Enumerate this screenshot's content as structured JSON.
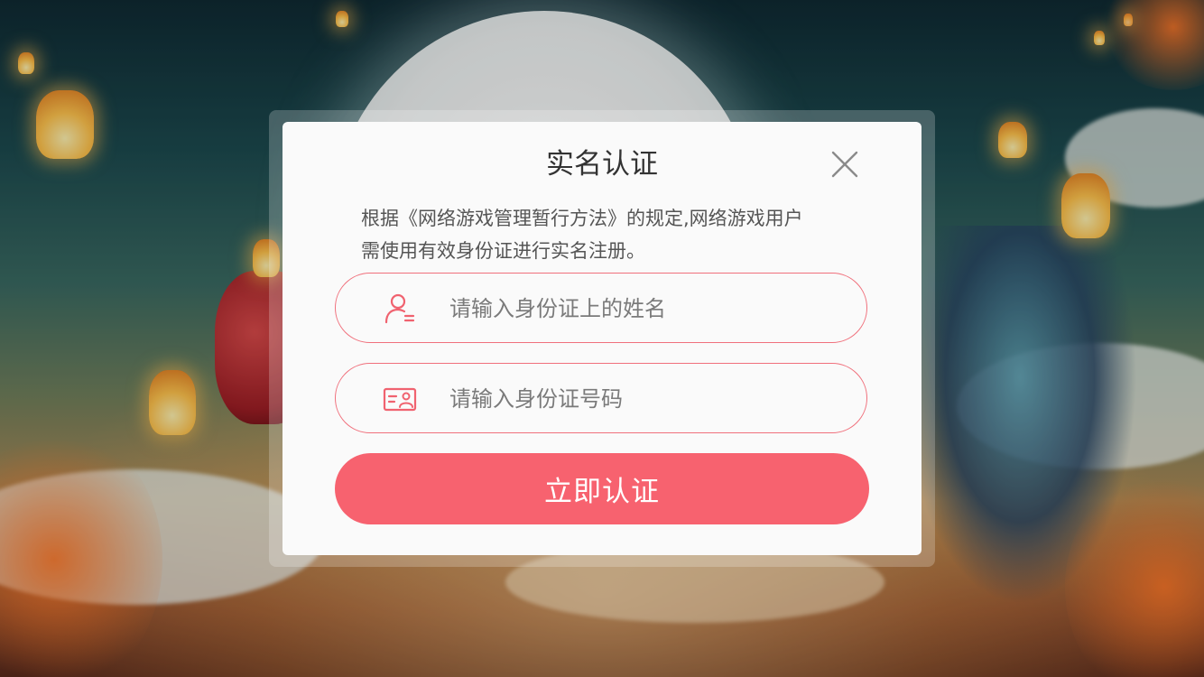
{
  "dialog": {
    "title": "实名认证",
    "notice_line1": "根据《网络游戏管理暂行方法》的规定,网络游戏用户",
    "notice_line2": "需使用有效身份证进行实名注册。",
    "name_field": {
      "placeholder": "请输入身份证上的姓名",
      "value": "",
      "icon": "user-profile-icon"
    },
    "id_field": {
      "placeholder": "请输入身份证号码",
      "value": "",
      "icon": "id-card-icon"
    },
    "submit_label": "立即认证",
    "close_icon": "close-icon"
  },
  "colors": {
    "accent": "#f7626f",
    "field_border": "#f0707c",
    "dialog_bg": "#fafafa",
    "title_text": "#333333",
    "body_text": "#555555"
  }
}
